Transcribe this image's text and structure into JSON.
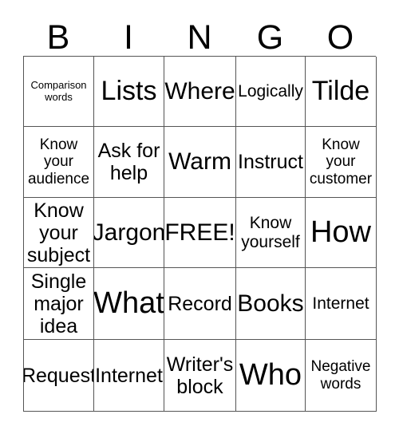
{
  "card": {
    "header_letters": [
      "B",
      "I",
      "N",
      "G",
      "O"
    ],
    "columns": 5,
    "rows": 5,
    "free_space_label": "FREE!",
    "border_color": "#555555",
    "background_color": "#ffffff",
    "text_color": "#000000",
    "cells": [
      [
        {
          "text": "Comparison\nwords",
          "size": "xxs"
        },
        {
          "text": "Lists",
          "size": "xl"
        },
        {
          "text": "Where",
          "size": "lg"
        },
        {
          "text": "Logically",
          "size": "sm"
        },
        {
          "text": "Tilde",
          "size": "xl"
        }
      ],
      [
        {
          "text": "Know\nyour\naudience",
          "size": "xs"
        },
        {
          "text": "Ask for\nhelp",
          "size": "md"
        },
        {
          "text": "Warm",
          "size": "lg"
        },
        {
          "text": "Instruct",
          "size": "md"
        },
        {
          "text": "Know\nyour\ncustomer",
          "size": "xs"
        }
      ],
      [
        {
          "text": "Know\nyour\nsubject",
          "size": "md"
        },
        {
          "text": "Jargon",
          "size": "lg"
        },
        {
          "text": "FREE!",
          "size": "lg"
        },
        {
          "text": "Know\nyourself",
          "size": "sm"
        },
        {
          "text": "How",
          "size": "xxl"
        }
      ],
      [
        {
          "text": "Single\nmajor\nidea",
          "size": "md"
        },
        {
          "text": "What",
          "size": "xxl"
        },
        {
          "text": "Record",
          "size": "md"
        },
        {
          "text": "Books",
          "size": "lg"
        },
        {
          "text": "Internet",
          "size": "sm"
        }
      ],
      [
        {
          "text": "Request",
          "size": "md"
        },
        {
          "text": "Internet",
          "size": "md"
        },
        {
          "text": "Writer's\nblock",
          "size": "md"
        },
        {
          "text": "Who",
          "size": "xxl"
        },
        {
          "text": "Negative\nwords",
          "size": "xs"
        }
      ]
    ]
  }
}
